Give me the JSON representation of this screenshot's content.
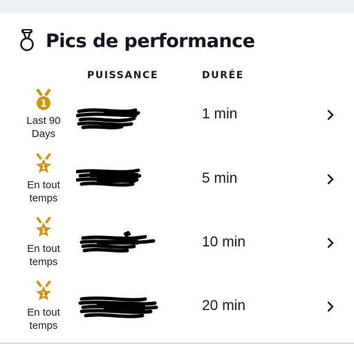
{
  "header": {
    "title": "Pics de performance",
    "icon": "medal-outline-icon"
  },
  "columns": {
    "power": "PUISSANCE",
    "duration": "DURÉE"
  },
  "accent_color": "#c9971c",
  "rows": [
    {
      "badge_icon": "gold-medal-icon",
      "badge_label": "Last 90\nDays",
      "power": "",
      "duration": "1 min"
    },
    {
      "badge_icon": "star-medal-icon",
      "badge_label": "En tout\ntemps",
      "power": "",
      "duration": "5 min"
    },
    {
      "badge_icon": "star-medal-icon",
      "badge_label": "En tout\ntemps",
      "power": "",
      "duration": "10 min"
    },
    {
      "badge_icon": "star-medal-icon",
      "badge_label": "En tout\ntemps",
      "power": "",
      "duration": "20 min"
    }
  ]
}
